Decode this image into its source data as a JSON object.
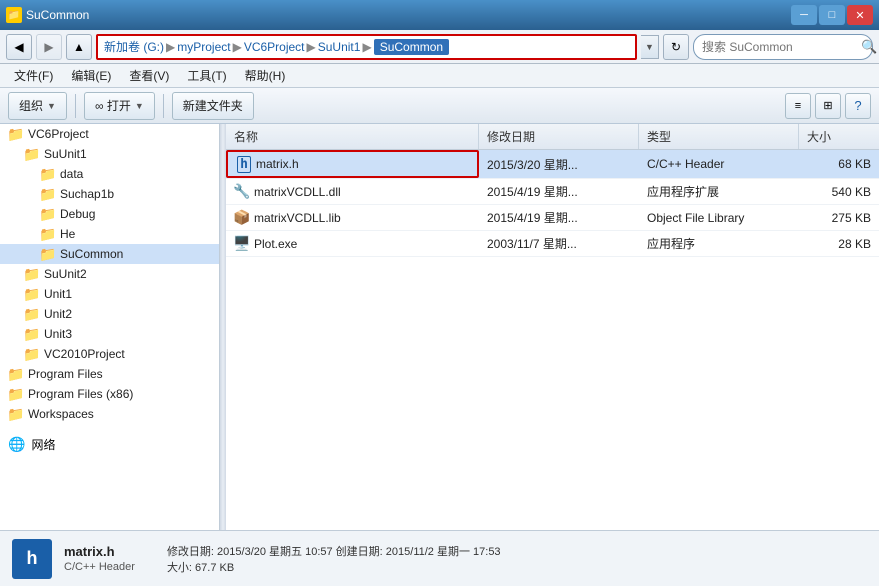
{
  "titleBar": {
    "title": "SuCommon",
    "minimizeLabel": "─",
    "maximizeLabel": "□",
    "closeLabel": "✕"
  },
  "addressBar": {
    "breadcrumbs": [
      {
        "label": "新加卷 (G:)",
        "active": false
      },
      {
        "label": "myProject",
        "active": false
      },
      {
        "label": "VC6Project",
        "active": false
      },
      {
        "label": "SuUnit1",
        "active": false
      },
      {
        "label": "SuCommon",
        "active": true
      }
    ],
    "searchPlaceholder": "搜索 SuCommon",
    "refreshIcon": "↻"
  },
  "menuBar": {
    "items": [
      "文件(F)",
      "编辑(E)",
      "查看(V)",
      "工具(T)",
      "帮助(H)"
    ]
  },
  "toolbar": {
    "organizeLabel": "组织",
    "openLabel": "∞ 打开",
    "newFolderLabel": "新建文件夹"
  },
  "leftPanel": {
    "items": [
      {
        "label": "VC6Project",
        "indent": 0,
        "type": "folder"
      },
      {
        "label": "SuUnit1",
        "indent": 1,
        "type": "folder"
      },
      {
        "label": "data",
        "indent": 2,
        "type": "folder"
      },
      {
        "label": "Suchap1b",
        "indent": 2,
        "type": "folder"
      },
      {
        "label": "Debug",
        "indent": 2,
        "type": "folder"
      },
      {
        "label": "He",
        "indent": 2,
        "type": "folder"
      },
      {
        "label": "SuCommon",
        "indent": 2,
        "type": "folder",
        "selected": true
      },
      {
        "label": "SuUnit2",
        "indent": 1,
        "type": "folder"
      },
      {
        "label": "Unit1",
        "indent": 1,
        "type": "folder"
      },
      {
        "label": "Unit2",
        "indent": 1,
        "type": "folder"
      },
      {
        "label": "Unit3",
        "indent": 1,
        "type": "folder"
      },
      {
        "label": "VC2010Project",
        "indent": 1,
        "type": "folder"
      },
      {
        "label": "Program Files",
        "indent": 0,
        "type": "folder"
      },
      {
        "label": "Program Files (x86)",
        "indent": 0,
        "type": "folder"
      },
      {
        "label": "Workspaces",
        "indent": 0,
        "type": "folder"
      }
    ],
    "networkLabel": "网络"
  },
  "fileList": {
    "columns": [
      "名称",
      "修改日期",
      "类型",
      "大小"
    ],
    "files": [
      {
        "name": "matrix.h",
        "date": "2015/3/20 星期...",
        "type": "C/C++ Header",
        "size": "68 KB",
        "iconType": "header",
        "selected": true
      },
      {
        "name": "matrixVCDLL.dll",
        "date": "2015/4/19 星期...",
        "type": "应用程序扩展",
        "size": "540 KB",
        "iconType": "dll",
        "selected": false
      },
      {
        "name": "matrixVCDLL.lib",
        "date": "2015/4/19 星期...",
        "type": "Object File Library",
        "size": "275 KB",
        "iconType": "lib",
        "selected": false
      },
      {
        "name": "Plot.exe",
        "date": "2003/11/7 星期...",
        "type": "应用程序",
        "size": "28 KB",
        "iconType": "exe",
        "selected": false
      }
    ]
  },
  "statusBar": {
    "fileName": "matrix.h",
    "fileType": "C/C++ Header",
    "details": "修改日期: 2015/3/20 星期五 10:57  创建日期: 2015/11/2 星期一 17:53",
    "sizeLabel": "大小: 67.7 KB",
    "iconLetter": "h"
  }
}
